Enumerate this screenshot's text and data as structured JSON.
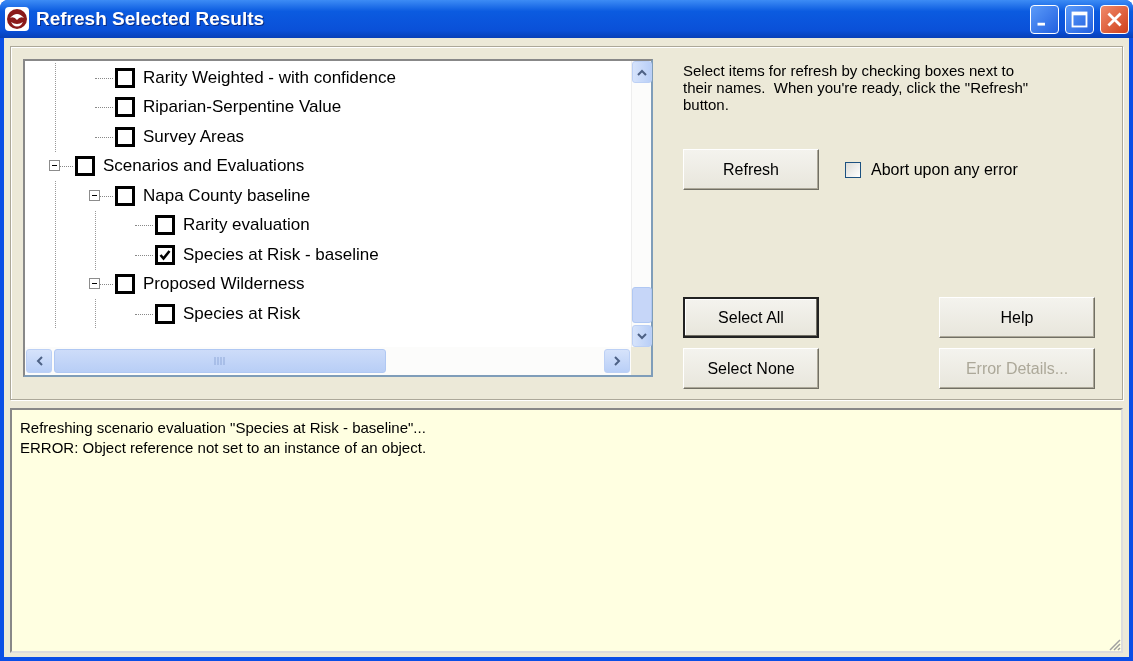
{
  "window": {
    "title": "Refresh Selected Results"
  },
  "tree": {
    "nodes": [
      {
        "children": [
          {
            "label": "Rarity Weighted - with confidence",
            "checked": false
          },
          {
            "label": "Riparian-Serpentine Value",
            "checked": false
          },
          {
            "label": "Survey Areas",
            "checked": false
          }
        ]
      },
      {
        "label": "Scenarios and Evaluations",
        "checked": false,
        "expanded": true,
        "children": [
          {
            "label": "Napa County baseline",
            "checked": false,
            "expanded": true,
            "children": [
              {
                "label": "Rarity evaluation",
                "checked": false
              },
              {
                "label": "Species at Risk - baseline",
                "checked": true
              }
            ]
          },
          {
            "label": "Proposed Wilderness",
            "checked": false,
            "expanded": true,
            "children": [
              {
                "label": "Species at Risk",
                "checked": false
              }
            ]
          }
        ]
      }
    ]
  },
  "instructions": "Select items for refresh by checking boxes next to their names.  When you're ready, click the \"Refresh\" button.",
  "refresh_button": {
    "label": "Refresh",
    "disabled": false,
    "focused": false
  },
  "abort_option": {
    "label": "Abort upon any error",
    "checked": false
  },
  "buttons": [
    {
      "kind": "select_all",
      "label": "Select All",
      "disabled": false,
      "focused": true
    },
    {
      "kind": "help",
      "label": "Help",
      "disabled": false,
      "focused": false
    },
    {
      "kind": "select_none",
      "label": "Select None",
      "disabled": false,
      "focused": false
    },
    {
      "kind": "error_details",
      "label": "Error Details...",
      "disabled": true,
      "focused": false
    }
  ],
  "log": {
    "lines": [
      "Refreshing scenario evaluation \"Species at Risk - baseline\"...",
      "ERROR:  Object reference not set to an instance of an object."
    ]
  }
}
